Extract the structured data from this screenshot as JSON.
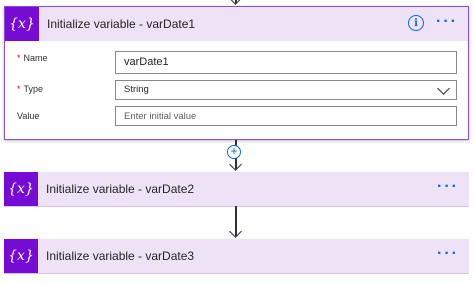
{
  "steps": [
    {
      "title": "Initialize variable - varDate1",
      "icon": "variable-icon",
      "icon_text": "{x}",
      "fields": {
        "name": {
          "label": "Name",
          "required_mark": "*",
          "value": "varDate1"
        },
        "type": {
          "label": "Type",
          "required_mark": "*",
          "value": "String"
        },
        "value": {
          "label": "Value",
          "placeholder": "Enter initial value"
        }
      },
      "info_text": "i",
      "more_text": "···"
    },
    {
      "title": "Initialize variable - varDate2",
      "icon": "variable-icon",
      "icon_text": "{x}",
      "more_text": "···"
    },
    {
      "title": "Initialize variable - varDate3",
      "icon": "variable-icon",
      "icon_text": "{x}",
      "more_text": "···"
    }
  ],
  "connector": {
    "add_text": "+"
  },
  "colors": {
    "accent": "#770bd6",
    "header_bg": "#eee2f7",
    "link_blue": "#0a6ad8",
    "selected_border": "#8a4fd8"
  }
}
